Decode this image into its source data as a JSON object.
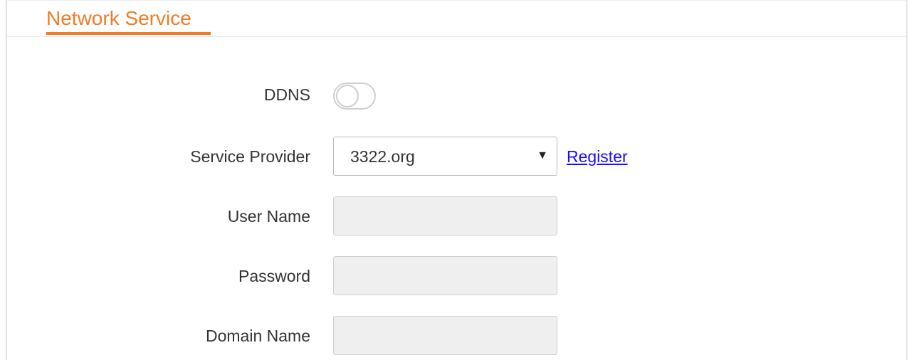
{
  "section": {
    "title": "Network Service"
  },
  "form": {
    "ddns": {
      "label": "DDNS",
      "enabled": false
    },
    "service_provider": {
      "label": "Service Provider",
      "value": "3322.org",
      "link_label": "Register"
    },
    "user_name": {
      "label": "User Name",
      "value": ""
    },
    "password": {
      "label": "Password",
      "value": ""
    },
    "domain_name": {
      "label": "Domain Name",
      "value": ""
    }
  },
  "colors": {
    "accent": "#f07b28",
    "link": "#1a0dff",
    "disabled_input": "#efefef"
  },
  "icons": {
    "select_arrow": "dropdown-arrow-icon"
  }
}
